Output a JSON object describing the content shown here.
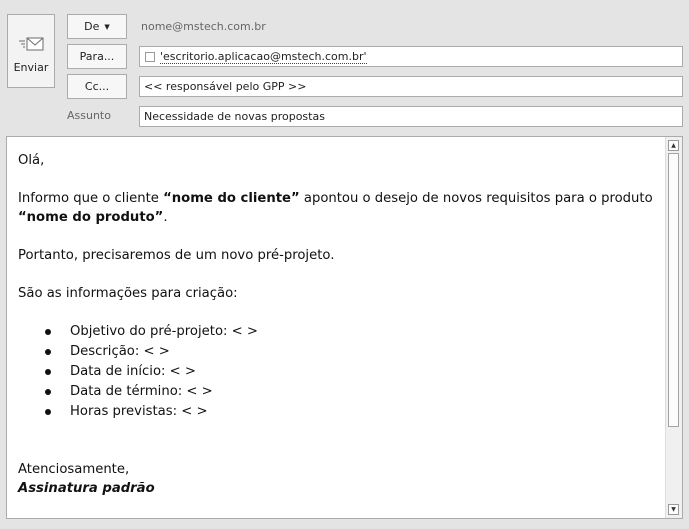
{
  "send": {
    "label": "Enviar",
    "icon": "envelope-send-icon"
  },
  "from": {
    "label": "De",
    "value": "nome@mstech.com.br"
  },
  "to": {
    "label": "Para...",
    "recipient": "'escritorio.aplicacao@mstech.com.br'"
  },
  "cc": {
    "label": "Cc...",
    "value": "<< responsável pelo GPP >>"
  },
  "subject": {
    "label": "Assunto",
    "value": "Necessidade de novas propostas"
  },
  "body": {
    "greeting": "Olá,",
    "p1_a": "Informo que o cliente ",
    "p1_client": "“nome do cliente”",
    "p1_b": " apontou o desejo de novos requisitos para o produto",
    "p1_product": "“nome do produto”",
    "p1_end": ".",
    "p2": "Portanto, precisaremos de um novo pré-projeto.",
    "p3": "São as informações para criação:",
    "bullets": [
      "Objetivo do pré-projeto: <  >",
      "Descrição: < >",
      "Data de início: <  >",
      "Data de término: <  >",
      "Horas previstas: <  >"
    ],
    "closing": "Atenciosamente,",
    "signature": "Assinatura padrão"
  }
}
